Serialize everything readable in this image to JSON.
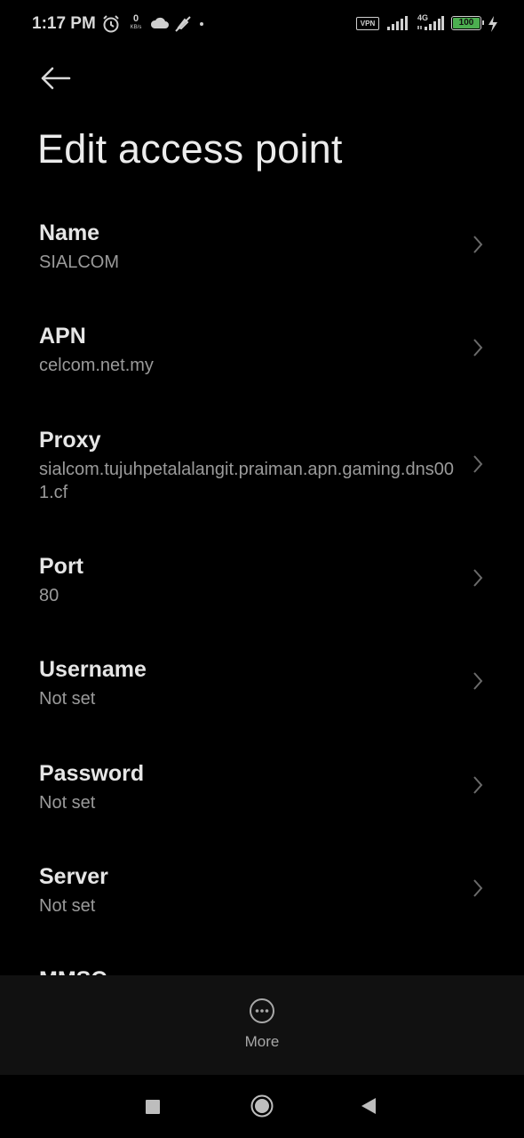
{
  "status_bar": {
    "time": "1:17 PM",
    "net_speed_value": "0",
    "net_speed_unit": "KB/s",
    "vpn_label": "VPN",
    "network_type": "4G",
    "battery_level": "100",
    "icons": [
      "alarm-icon",
      "cloud-icon",
      "mute-icon",
      "signal-icon",
      "signal-4g-icon",
      "battery-icon",
      "charging-icon"
    ]
  },
  "header": {
    "title": "Edit access point"
  },
  "settings": [
    {
      "label": "Name",
      "value": "SIALCOM"
    },
    {
      "label": "APN",
      "value": "celcom.net.my"
    },
    {
      "label": "Proxy",
      "value": "sialcom.tujuhpetalalangit.praiman.apn.gaming.dns001.cf"
    },
    {
      "label": "Port",
      "value": "80"
    },
    {
      "label": "Username",
      "value": "Not set"
    },
    {
      "label": "Password",
      "value": "Not set"
    },
    {
      "label": "Server",
      "value": "Not set"
    },
    {
      "label": "MMSC",
      "value": ""
    }
  ],
  "bottom_bar": {
    "more_label": "More"
  },
  "colors": {
    "background": "#000000",
    "bottom_bar": "#111111",
    "label": "#e6e6e6",
    "value": "#9a9a9a",
    "battery": "#4caf50"
  }
}
